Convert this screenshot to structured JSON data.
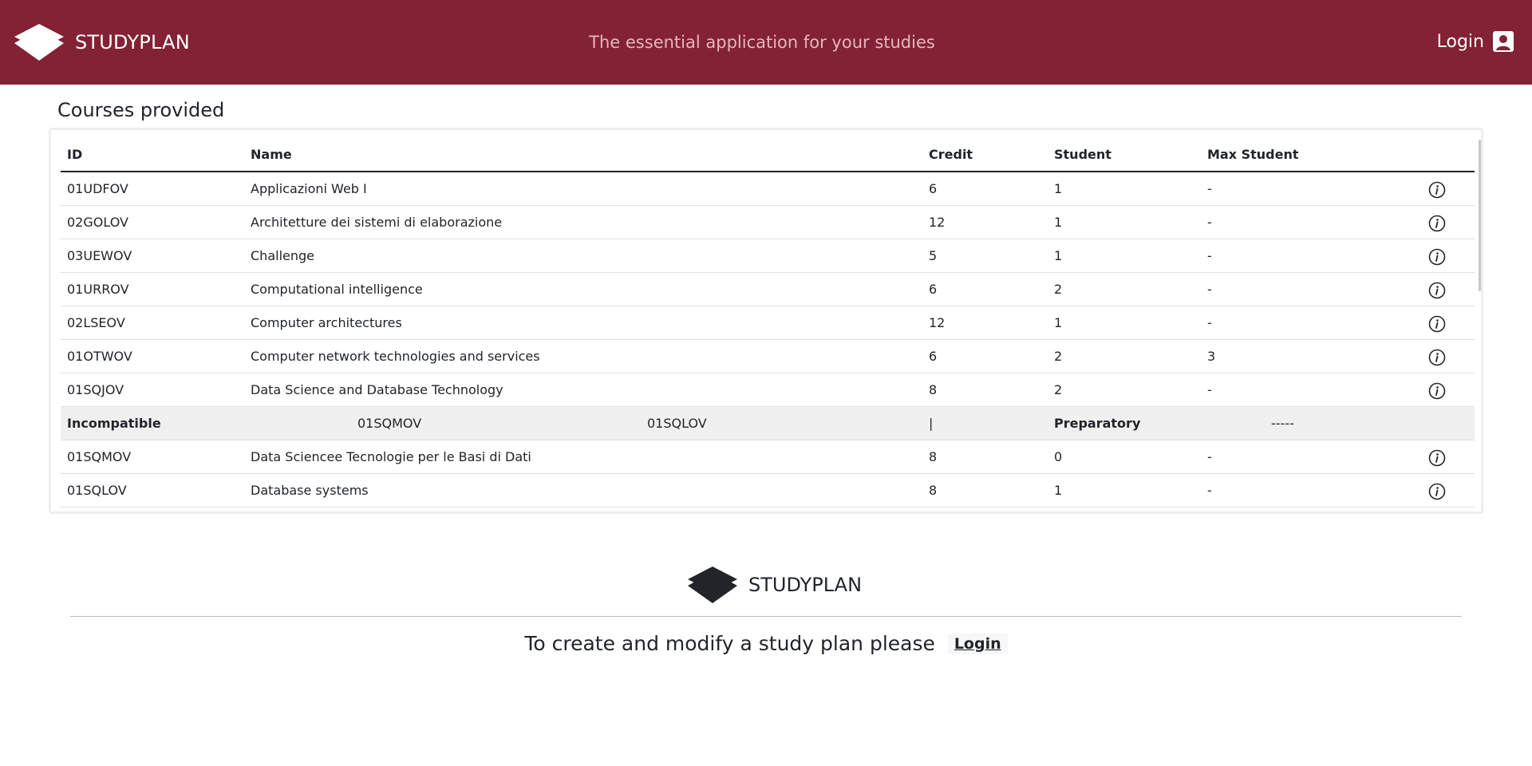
{
  "header": {
    "brand": "STUDYPLAN",
    "tagline": "The essential application for your studies",
    "login_label": "Login"
  },
  "main": {
    "title": "Courses provided",
    "table": {
      "columns": [
        "ID",
        "Name",
        "Credit",
        "Student",
        "Max Student"
      ],
      "rows": [
        {
          "id": "01UDFOV",
          "name": "Applicazioni Web I",
          "credit": "6",
          "student": "1",
          "max": "-"
        },
        {
          "id": "02GOLOV",
          "name": "Architetture dei sistemi di elaborazione",
          "credit": "12",
          "student": "1",
          "max": "-"
        },
        {
          "id": "03UEWOV",
          "name": "Challenge",
          "credit": "5",
          "student": "1",
          "max": "-"
        },
        {
          "id": "01URROV",
          "name": "Computational intelligence",
          "credit": "6",
          "student": "2",
          "max": "-"
        },
        {
          "id": "02LSEOV",
          "name": "Computer architectures",
          "credit": "12",
          "student": "1",
          "max": "-"
        },
        {
          "id": "01OTWOV",
          "name": "Computer network technologies and services",
          "credit": "6",
          "student": "2",
          "max": "3"
        },
        {
          "id": "01SQJOV",
          "name": "Data Science and Database Technology",
          "credit": "8",
          "student": "2",
          "max": "-"
        },
        {
          "id": "01SQMOV",
          "name": "Data Sciencee Tecnologie per le Basi di Dati",
          "credit": "8",
          "student": "0",
          "max": "-"
        },
        {
          "id": "01SQLOV",
          "name": "Database systems",
          "credit": "8",
          "student": "1",
          "max": "-"
        }
      ],
      "expanded_detail": {
        "incompatible_label": "Incompatible",
        "incompatible": [
          "01SQMOV",
          "01SQLOV"
        ],
        "separator": "|",
        "preparatory_label": "Preparatory",
        "preparatory": "-----"
      }
    }
  },
  "footer": {
    "brand": "STUDYPLAN",
    "message": "To create and modify a study plan please",
    "login_label": "Login"
  },
  "colors": {
    "navbar": "#832234",
    "tagline": "#e3b8bf"
  },
  "icons": {
    "logo": "layers-icon",
    "login": "user-square-icon",
    "row_info": "info-circle-icon"
  }
}
